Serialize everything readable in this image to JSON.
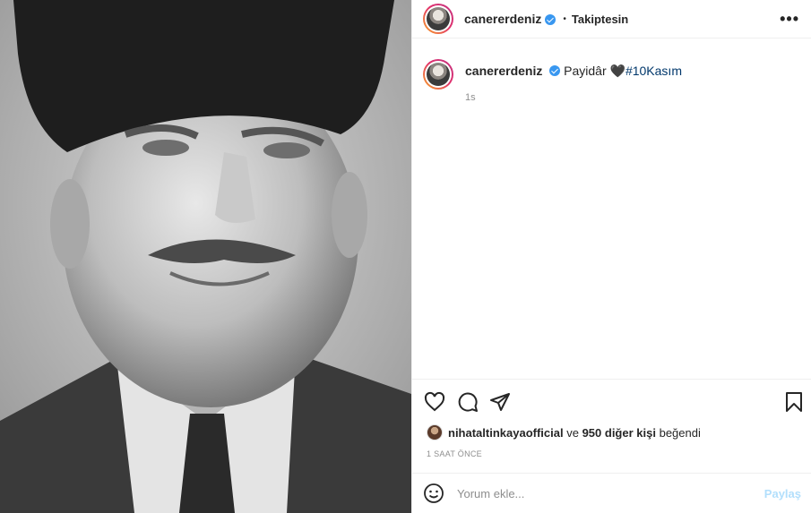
{
  "post": {
    "image_alt": "Black and white portrait photograph"
  },
  "header": {
    "username": "canererdeniz",
    "separator": "•",
    "follow_status": "Takiptesin",
    "more_icon": "more-horizontal-icon",
    "more_label": "•••"
  },
  "caption": {
    "username": "canererdeniz",
    "text": "Payidâr 🖤",
    "hashtag": "#10Kasım",
    "time": "1s"
  },
  "actions": {
    "like_icon": "heart-icon",
    "comment_icon": "comment-icon",
    "share_icon": "paper-plane-icon",
    "save_icon": "bookmark-icon"
  },
  "likes": {
    "first_user": "nihataltinkayaofficial",
    "connector": "ve",
    "others": "950 diğer kişi",
    "suffix": "beğendi"
  },
  "timestamp": "1 SAAT ÖNCE",
  "comment_box": {
    "placeholder": "Yorum ekle...",
    "post_label": "Paylaş",
    "emoji_icon": "smiley-icon"
  },
  "colors": {
    "verified": "#3897f0",
    "hashtag": "#00376b",
    "post_button_disabled": "#b2dffc",
    "muted": "#8e8e8e"
  }
}
